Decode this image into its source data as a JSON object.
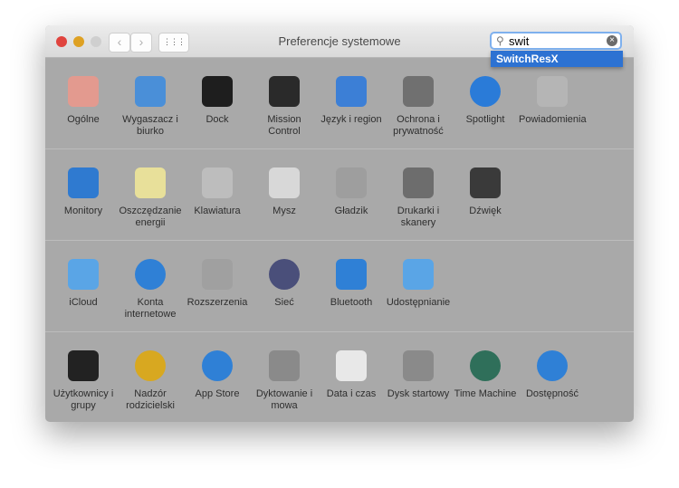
{
  "window": {
    "title": "Preferencje systemowe"
  },
  "toolbar": {
    "back": "‹",
    "forward": "›",
    "grid": "⋮⋮⋮"
  },
  "search": {
    "value": "swit",
    "suggestion": "SwitchResX"
  },
  "sections": [
    {
      "items": [
        {
          "label": "Ogólne",
          "icon": "general-icon",
          "color": "#e39a8f"
        },
        {
          "label": "Wygaszacz i biurko",
          "icon": "desktop-screensaver-icon",
          "color": "#4a8fd8"
        },
        {
          "label": "Dock",
          "icon": "dock-icon",
          "color": "#1e1e1e"
        },
        {
          "label": "Mission Control",
          "icon": "mission-control-icon",
          "color": "#2a2a2a"
        },
        {
          "label": "Język i region",
          "icon": "language-region-flag-icon",
          "color": "#3c7fd6"
        },
        {
          "label": "Ochrona i prywatność",
          "icon": "security-house-icon",
          "color": "#707070"
        },
        {
          "label": "Spotlight",
          "icon": "spotlight-magnifier-icon",
          "color": "#2a7bd8"
        },
        {
          "label": "Powiadomienia",
          "icon": "notifications-icon",
          "color": "#b5b5b5"
        }
      ]
    },
    {
      "items": [
        {
          "label": "Monitory",
          "icon": "display-icon",
          "color": "#2f7ad0"
        },
        {
          "label": "Oszczędzanie energii",
          "icon": "lightbulb-icon",
          "color": "#e8e09a"
        },
        {
          "label": "Klawiatura",
          "icon": "keyboard-icon",
          "color": "#bdbdbd"
        },
        {
          "label": "Mysz",
          "icon": "mouse-icon",
          "color": "#d8d8d8"
        },
        {
          "label": "Gładzik",
          "icon": "trackpad-icon",
          "color": "#9e9e9e"
        },
        {
          "label": "Drukarki i skanery",
          "icon": "printer-icon",
          "color": "#6d6d6d"
        },
        {
          "label": "Dźwięk",
          "icon": "speaker-icon",
          "color": "#3a3a3a"
        }
      ]
    },
    {
      "items": [
        {
          "label": "iCloud",
          "icon": "icloud-icon",
          "color": "#5aa5e6"
        },
        {
          "label": "Konta internetowe",
          "icon": "internet-accounts-at-icon",
          "color": "#2f80d6"
        },
        {
          "label": "Rozszerzenia",
          "icon": "extensions-puzzle-icon",
          "color": "#a0a0a0"
        },
        {
          "label": "Sieć",
          "icon": "network-globe-icon",
          "color": "#4a4f7a"
        },
        {
          "label": "Bluetooth",
          "icon": "bluetooth-icon",
          "color": "#2f80d6"
        },
        {
          "label": "Udostępnianie",
          "icon": "sharing-folder-icon",
          "color": "#5aa5e6"
        }
      ]
    },
    {
      "items": [
        {
          "label": "Użytkownicy i grupy",
          "icon": "users-groups-icon",
          "color": "#222222"
        },
        {
          "label": "Nadzór rodzicielski",
          "icon": "parental-controls-icon",
          "color": "#d8a820"
        },
        {
          "label": "App Store",
          "icon": "app-store-icon",
          "color": "#2f80d6"
        },
        {
          "label": "Dyktowanie i mowa",
          "icon": "dictation-microphone-icon",
          "color": "#8a8a8a"
        },
        {
          "label": "Data i czas",
          "icon": "date-time-clock-icon",
          "color": "#e8e8e8"
        },
        {
          "label": "Dysk startowy",
          "icon": "startup-disk-icon",
          "color": "#8a8a8a"
        },
        {
          "label": "Time Machine",
          "icon": "time-machine-icon",
          "color": "#2f6f5a"
        },
        {
          "label": "Dostępność",
          "icon": "accessibility-icon",
          "color": "#2f80d6"
        }
      ]
    }
  ]
}
